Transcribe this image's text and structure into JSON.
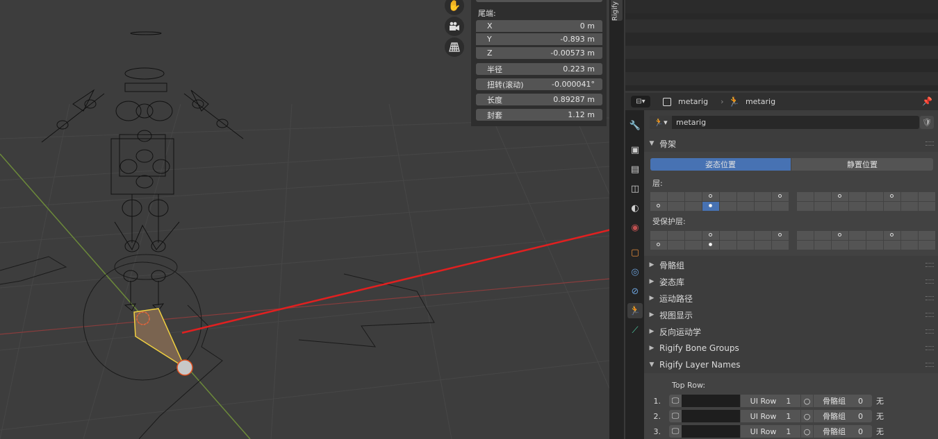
{
  "viewport": {
    "nav_icons": [
      "hand-icon",
      "camera-icon",
      "grid-icon"
    ]
  },
  "npanel": {
    "tail_label": "尾端:",
    "fields": [
      {
        "label": "X",
        "value": "0 m"
      },
      {
        "label": "Y",
        "value": "-0.893 m"
      },
      {
        "label": "Z",
        "value": "-0.00573 m"
      },
      {
        "label": "半径",
        "value": "0.223 m"
      },
      {
        "label": "扭转(滚动)",
        "value": "-0.000041°"
      },
      {
        "label": "长度",
        "value": "0.89287 m"
      },
      {
        "label": "封套",
        "value": "1.12 m"
      }
    ]
  },
  "rigify_tab": {
    "label": "Rigify"
  },
  "props_header": {
    "object_name": "metarig",
    "data_name": "metarig"
  },
  "armature_selector": {
    "value": "metarig"
  },
  "skeleton_panel": {
    "title": "骨架",
    "pose_position": "姿态位置",
    "rest_position": "静置位置",
    "layers_label": "层:",
    "protected_label": "受保护层:"
  },
  "collapsed_panels": [
    "骨骼组",
    "姿态库",
    "运动路径",
    "视图显示",
    "反向运动学",
    "Rigify Bone Groups"
  ],
  "layer_names_panel": {
    "title": "Rigify Layer Names",
    "top_row_label": "Top Row:",
    "rows": [
      {
        "num": "1.",
        "ui_row_label": "UI Row",
        "ui_row_value": "1",
        "group_label": "骨骼组",
        "group_value": "0",
        "none_label": "无"
      },
      {
        "num": "2.",
        "ui_row_label": "UI Row",
        "ui_row_value": "1",
        "group_label": "骨骼组",
        "group_value": "0",
        "none_label": "无"
      },
      {
        "num": "3.",
        "ui_row_label": "UI Row",
        "ui_row_value": "1",
        "group_label": "骨骼组",
        "group_value": "0",
        "none_label": "无"
      }
    ]
  },
  "colors": {
    "accent": "#4772b3",
    "arrow": "#e02020",
    "selected_bone": "#f0d040"
  }
}
